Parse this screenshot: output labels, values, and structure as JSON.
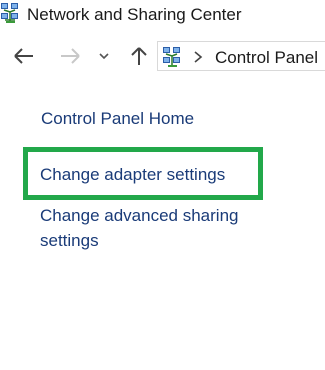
{
  "window": {
    "title": "Network and Sharing Center",
    "icon": "network-icon"
  },
  "nav": {
    "back_icon": "arrow-left-icon",
    "forward_icon": "arrow-right-icon",
    "recent_icon": "chevron-down-icon",
    "up_icon": "arrow-up-icon",
    "address": {
      "icon": "control-panel-icon",
      "separator_icon": "chevron-right-icon",
      "crumb": "Control Panel"
    }
  },
  "sidebar": {
    "home_link": "Control Panel Home",
    "links": [
      "Change adapter settings",
      "Change advanced sharing settings"
    ]
  },
  "colors": {
    "link": "#1a3b78",
    "highlight": "#22a84a",
    "text": "#1a1a1a"
  }
}
